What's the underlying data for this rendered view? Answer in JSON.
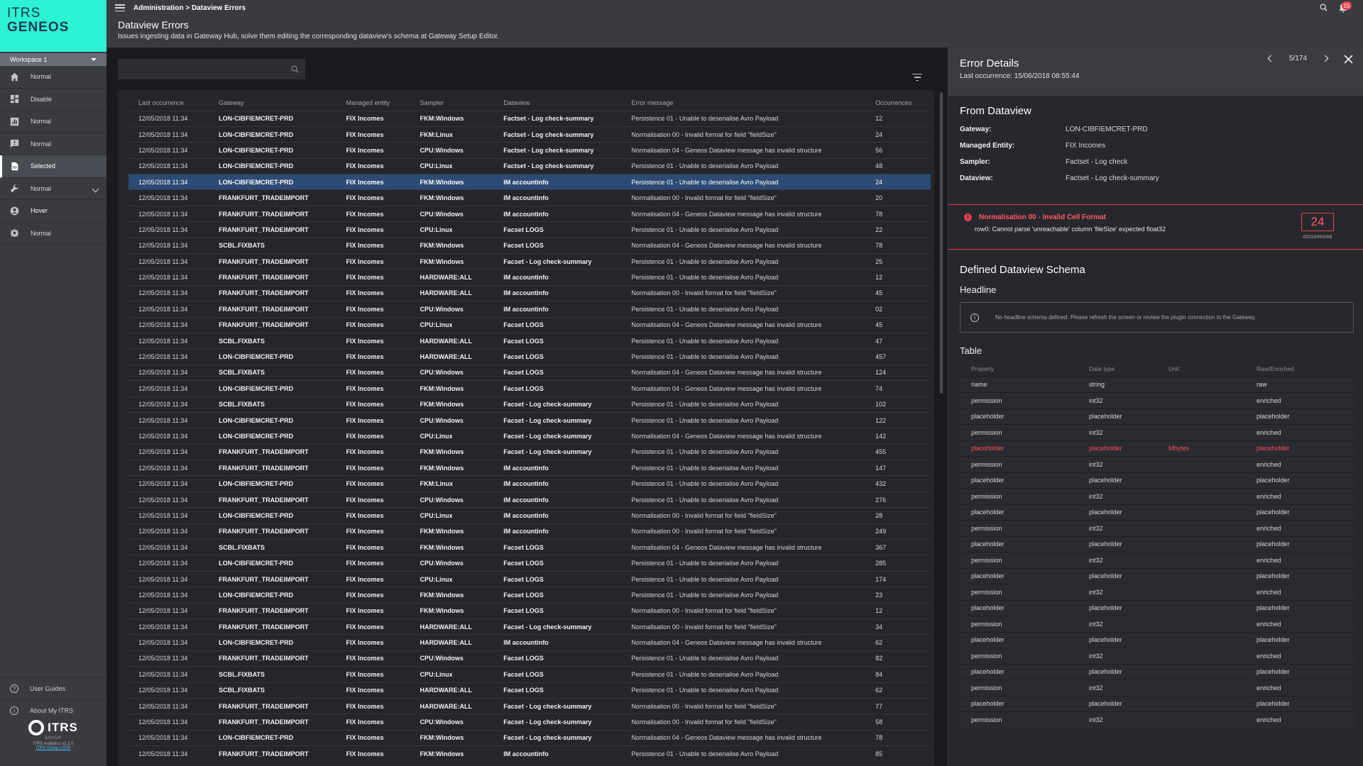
{
  "sidebar": {
    "logo_line1": "ITRS",
    "logo_line2": "GENEOS",
    "workspace": "Workspace 1",
    "items": [
      {
        "label": "Normal"
      },
      {
        "label": "Disable"
      },
      {
        "label": "Normal"
      },
      {
        "label": "Normal"
      },
      {
        "label": "Selected"
      },
      {
        "label": "Normal"
      },
      {
        "label": "Hover"
      },
      {
        "label": "Normal"
      }
    ],
    "user_guides": "User Guides",
    "about": "About My ITRS",
    "brand": "ITRS",
    "brand_sub": "GROUP",
    "version": "ITRS Analytics v1.2.0",
    "company_link": "ITRS Group LTD®"
  },
  "topbar": {
    "breadcrumb": "Administration > Dataview Errors",
    "notifications": "15"
  },
  "header": {
    "title": "Dataview Errors",
    "subtitle": "Issues ingesting data in Gateway Hub, solve them editing the corresponding dataview's schema at Gateway Setup Editor."
  },
  "table": {
    "columns": [
      "Last occurrence",
      "Gateway",
      "Managed entity",
      "Sampler",
      "Dataview",
      "Error message",
      "Occurrences"
    ],
    "selected_index": 4,
    "rows": [
      [
        "12/05/2018 11:34",
        "LON-CIBFIEMCRET-PRD",
        "FIX Incomes",
        "FKM:Windows",
        "Factset - Log check-summary",
        "Persistence 01 - Unable to deserialise Avro Payload",
        "12"
      ],
      [
        "12/05/2018 11:34",
        "LON-CIBFIEMCRET-PRD",
        "FIX Incomes",
        "FKM:Linux",
        "Factset - Log check-summary",
        "Normalisation 00 - Invalid format for field \"fieldSize\"",
        "24"
      ],
      [
        "12/05/2018 11:34",
        "LON-CIBFIEMCRET-PRD",
        "FIX Incomes",
        "CPU:Windows",
        "Factset - Log check-summary",
        "Normalisation 04 - Geneos Dataview message has invalid structure",
        "56"
      ],
      [
        "12/05/2018 11:34",
        "LON-CIBFIEMCRET-PRD",
        "FIX Incomes",
        "CPU:Linux",
        "Factset - Log check-summary",
        "Persistence 01 - Unable to deserialise Avro Payload",
        "48"
      ],
      [
        "12/05/2018 11:34",
        "LON-CIBFIEMCRET-PRD",
        "FIX Incomes",
        "FKM:Windows",
        "IM accountinfo",
        "Persistence 01 - Unable to deserialise Avro Payload",
        "24"
      ],
      [
        "12/05/2018 11:34",
        "FRANKFURT_TRADEIMPORT",
        "FIX Incomes",
        "FKM:Windows",
        "IM accountinfo",
        "Normalisation 00 - Invalid format for field \"fieldSize\"",
        "20"
      ],
      [
        "12/05/2018 11:34",
        "FRANKFURT_TRADEIMPORT",
        "FIX Incomes",
        "CPU:Windows",
        "IM accountinfo",
        "Normalisation 04 - Geneos Dataview message has invalid structure",
        "78"
      ],
      [
        "12/05/2018 11:34",
        "FRANKFURT_TRADEIMPORT",
        "FIX Incomes",
        "CPU:Linux",
        "Facset LOGS",
        "Persistence 01 - Unable to deserialise Avro Payload",
        "22"
      ],
      [
        "12/05/2018 11:34",
        "SCBL.FIXBATS",
        "FIX Incomes",
        "FKM:Windows",
        "Facset LOGS",
        "Normalisation 04 - Geneos Dataview message has invalid structure",
        "78"
      ],
      [
        "12/05/2018 11:34",
        "FRANKFURT_TRADEIMPORT",
        "FIX Incomes",
        "FKM:Windows",
        "Facset - Log check-summary",
        "Persistence 01 - Unable to deserialise Avro Payload",
        "25"
      ],
      [
        "12/05/2018 11:34",
        "FRANKFURT_TRADEIMPORT",
        "FIX Incomes",
        "HARDWARE:ALL",
        "IM accountinfo",
        "Persistence 01 - Unable to deserialise Avro Payload",
        "12"
      ],
      [
        "12/05/2018 11:34",
        "FRANKFURT_TRADEIMPORT",
        "FIX Incomes",
        "HARDWARE:ALL",
        "IM accountinfo",
        "Normalisation 00 - Invalid format for field \"fieldSize\"",
        "45"
      ],
      [
        "12/05/2018 11:34",
        "FRANKFURT_TRADEIMPORT",
        "FIX Incomes",
        "CPU:Windows",
        "IM accountinfo",
        "Persistence 01 - Unable to deserialise Avro Payload",
        "02"
      ],
      [
        "12/05/2018 11:34",
        "FRANKFURT_TRADEIMPORT",
        "FIX Incomes",
        "CPU:Linux",
        "Facset LOGS",
        "Normalisation 04 - Geneos Dataview message has invalid structure",
        "45"
      ],
      [
        "12/05/2018 11:34",
        "SCBL.FIXBATS",
        "FIX Incomes",
        "HARDWARE:ALL",
        "Facset LOGS",
        "Persistence 01 - Unable to deserialise Avro Payload",
        "47"
      ],
      [
        "12/05/2018 11:34",
        "LON-CIBFIEMCRET-PRD",
        "FIX Incomes",
        "HARDWARE:ALL",
        "Facset LOGS",
        "Persistence 01 - Unable to deserialise Avro Payload",
        "457"
      ],
      [
        "12/05/2018 11:34",
        "SCBL.FIXBATS",
        "FIX Incomes",
        "CPU:Windows",
        "Facset LOGS",
        "Normalisation 04 - Geneos Dataview message has invalid structure",
        "124"
      ],
      [
        "12/05/2018 11:34",
        "LON-CIBFIEMCRET-PRD",
        "FIX Incomes",
        "FKM:Windows",
        "Facset LOGS",
        "Normalisation 04 - Geneos Dataview message has invalid structure",
        "74"
      ],
      [
        "12/05/2018 11:34",
        "SCBL.FIXBATS",
        "FIX Incomes",
        "FKM:Windows",
        "Facset - Log check-summary",
        "Persistence 01 - Unable to deserialise Avro Payload",
        "102"
      ],
      [
        "12/05/2018 11:34",
        "LON-CIBFIEMCRET-PRD",
        "FIX Incomes",
        "CPU:Windows",
        "Facset - Log check-summary",
        "Persistence 01 - Unable to deserialise Avro Payload",
        "122"
      ],
      [
        "12/05/2018 11:34",
        "LON-CIBFIEMCRET-PRD",
        "FIX Incomes",
        "CPU:Linux",
        "Facset - Log check-summary",
        "Normalisation 04 - Geneos Dataview message has invalid structure",
        "142"
      ],
      [
        "12/05/2018 11:34",
        "FRANKFURT_TRADEIMPORT",
        "FIX Incomes",
        "FKM:Windows",
        "Facset - Log check-summary",
        "Persistence 01 - Unable to deserialise Avro Payload",
        "455"
      ],
      [
        "12/05/2018 11:34",
        "FRANKFURT_TRADEIMPORT",
        "FIX Incomes",
        "FKM:Windows",
        "IM accountinfo",
        "Persistence 01 - Unable to deserialise Avro Payload",
        "147"
      ],
      [
        "12/05/2018 11:34",
        "LON-CIBFIEMCRET-PRD",
        "FIX Incomes",
        "FKM:Linux",
        "IM accountinfo",
        "Persistence 01 - Unable to deserialise Avro Payload",
        "432"
      ],
      [
        "12/05/2018 11:34",
        "FRANKFURT_TRADEIMPORT",
        "FIX Incomes",
        "CPU:Windows",
        "IM accountinfo",
        "Persistence 01 - Unable to deserialise Avro Payload",
        "276"
      ],
      [
        "12/05/2018 11:34",
        "LON-CIBFIEMCRET-PRD",
        "FIX Incomes",
        "CPU:Linux",
        "IM accountinfo",
        "Normalisation 00 - Invalid format for field \"fieldSize\"",
        "28"
      ],
      [
        "12/05/2018 11:34",
        "FRANKFURT_TRADEIMPORT",
        "FIX Incomes",
        "FKM:Windows",
        "IM accountinfo",
        "Normalisation 00 - Invalid format for field \"fieldSize\"",
        "249"
      ],
      [
        "12/05/2018 11:34",
        "SCBL.FIXBATS",
        "FIX Incomes",
        "FKM:Windows",
        "Facset LOGS",
        "Normalisation 04 - Geneos Dataview message has invalid structure",
        "367"
      ],
      [
        "12/05/2018 11:34",
        "LON-CIBFIEMCRET-PRD",
        "FIX Incomes",
        "CPU:Windows",
        "Facset LOGS",
        "Persistence 01 - Unable to deserialise Avro Payload",
        "285"
      ],
      [
        "12/05/2018 11:34",
        "FRANKFURT_TRADEIMPORT",
        "FIX Incomes",
        "CPU:Linux",
        "Facset LOGS",
        "Persistence 01 - Unable to deserialise Avro Payload",
        "174"
      ],
      [
        "12/05/2018 11:34",
        "LON-CIBFIEMCRET-PRD",
        "FIX Incomes",
        "FKM:Windows",
        "Facset LOGS",
        "Persistence 01 - Unable to deserialise Avro Payload",
        "23"
      ],
      [
        "12/05/2018 11:34",
        "FRANKFURT_TRADEIMPORT",
        "FIX Incomes",
        "FKM:Windows",
        "Facset LOGS",
        "Normalisation 00 - Invalid format for field \"fieldSize\"",
        "12"
      ],
      [
        "12/05/2018 11:34",
        "FRANKFURT_TRADEIMPORT",
        "FIX Incomes",
        "HARDWARE:ALL",
        "Facset - Log check-summary",
        "Normalisation 00 - Invalid format for field \"fieldSize\"",
        "34"
      ],
      [
        "12/05/2018 11:34",
        "LON-CIBFIEMCRET-PRD",
        "FIX Incomes",
        "HARDWARE:ALL",
        "IM accountinfo",
        "Normalisation 04 - Geneos Dataview message has invalid structure",
        "62"
      ],
      [
        "12/05/2018 11:34",
        "FRANKFURT_TRADEIMPORT",
        "FIX Incomes",
        "CPU:Windows",
        "Facset LOGS",
        "Persistence 01 - Unable to deserialise Avro Payload",
        "82"
      ],
      [
        "12/05/2018 11:34",
        "SCBL.FIXBATS",
        "FIX Incomes",
        "CPU:Linux",
        "Facset LOGS",
        "Persistence 01 - Unable to deserialise Avro Payload",
        "84"
      ],
      [
        "12/05/2018 11:34",
        "SCBL.FIXBATS",
        "FIX Incomes",
        "HARDWARE:ALL",
        "Facset LOGS",
        "Persistence 01 - Unable to deserialise Avro Payload",
        "62"
      ],
      [
        "12/05/2018 11:34",
        "FRANKFURT_TRADEIMPORT",
        "FIX Incomes",
        "HARDWARE:ALL",
        "Facset - Log check-summary",
        "Normalisation 00 - Invalid format for field \"fieldSize\"",
        "77"
      ],
      [
        "12/05/2018 11:34",
        "FRANKFURT_TRADEIMPORT",
        "FIX Incomes",
        "CPU:Windows",
        "Facset - Log check-summary",
        "Normalisation 00 - Invalid format for field \"fieldSize\"",
        "58"
      ],
      [
        "12/05/2018 11:34",
        "LON-CIBFIEMCRET-PRD",
        "FIX Incomes",
        "FKM:Windows",
        "Facset - Log check-summary",
        "Normalisation 04 - Geneos Dataview message has invalid structure",
        "78"
      ],
      [
        "12/05/2018 11:34",
        "FRANKFURT_TRADEIMPORT",
        "FIX Incomes",
        "FKM:Windows",
        "IM accountinfo",
        "Persistence 01 - Unable to deserialise Avro Payload",
        "85"
      ]
    ]
  },
  "details": {
    "title": "Error Details",
    "last_occurrence": "Last occurrence: 15/06/2018 08:55:44",
    "pager": "5/174",
    "from_title": "From Dataview",
    "fields": [
      {
        "k": "Gateway:",
        "v": "LON-CIBFIEMCRET-PRD"
      },
      {
        "k": "Managed Entity:",
        "v": "FIX Incomes"
      },
      {
        "k": "Sampler:",
        "v": "Factset - Log check"
      },
      {
        "k": "Dataview:",
        "v": "Factset - Log check-summary"
      }
    ],
    "error": {
      "title": "Normalisation 00 - Invalid Cell Format",
      "message": "row0: Cannot parse 'unreachable' column 'fileSize' expected float32",
      "count": "24",
      "count_label": "occurences"
    },
    "schema_title": "Defined Dataview Schema",
    "headline_label": "Headline",
    "headline_msg": "No headline schema defined. Please refresh the screen or review the plugin connection to the Gateway.",
    "table_label": "Table",
    "schema_columns": [
      "Property",
      "Data type",
      "Unit",
      "Raw/Enriched"
    ],
    "schema_error_index": 4,
    "schema_rows": [
      [
        "name",
        "string",
        "",
        "raw"
      ],
      [
        "permission",
        "int32",
        "",
        "enriched"
      ],
      [
        "placeholder",
        "placeholder",
        "",
        "placeholder"
      ],
      [
        "permission",
        "int32",
        "",
        "enriched"
      ],
      [
        "placeholder",
        "placeholder",
        "Mbytes",
        "placeholder"
      ],
      [
        "permission",
        "int32",
        "",
        "enriched"
      ],
      [
        "placeholder",
        "placeholder",
        "",
        "placeholder"
      ],
      [
        "permission",
        "int32",
        "",
        "enriched"
      ],
      [
        "placeholder",
        "placeholder",
        "",
        "placeholder"
      ],
      [
        "permission",
        "int32",
        "",
        "enriched"
      ],
      [
        "placeholder",
        "placeholder",
        "",
        "placeholder"
      ],
      [
        "permission",
        "int32",
        "",
        "enriched"
      ],
      [
        "placeholder",
        "placeholder",
        "",
        "placeholder"
      ],
      [
        "permission",
        "int32",
        "",
        "enriched"
      ],
      [
        "placeholder",
        "placeholder",
        "",
        "placeholder"
      ],
      [
        "permission",
        "int32",
        "",
        "enriched"
      ],
      [
        "placeholder",
        "placeholder",
        "",
        "placeholder"
      ],
      [
        "permission",
        "int32",
        "",
        "enriched"
      ],
      [
        "placeholder",
        "placeholder",
        "",
        "placeholder"
      ],
      [
        "permission",
        "int32",
        "",
        "enriched"
      ],
      [
        "placeholder",
        "placeholder",
        "",
        "placeholder"
      ],
      [
        "permission",
        "int32",
        "",
        "enriched"
      ]
    ]
  },
  "colors": {
    "brand": "#2ef2d4",
    "selected_row": "#2c4a74",
    "error": "#e0414e"
  }
}
